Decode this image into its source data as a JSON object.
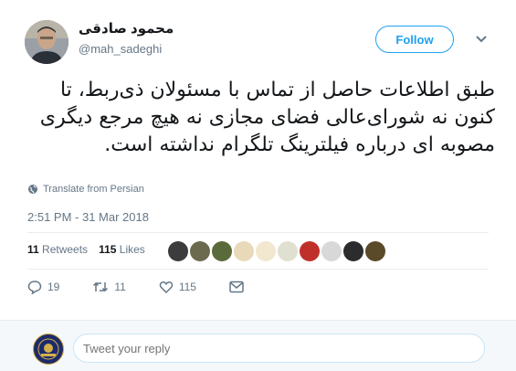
{
  "user": {
    "display_name": "محمود صادقی",
    "handle": "@mah_sadeghi"
  },
  "header": {
    "follow_label": "Follow"
  },
  "tweet": {
    "text": "طبق اطلاعات حاصل از تماس با مسئولان ذی‌ربط، تا کنون نه شورای‌عالی فضای مجازی نه هیچ مرجع دیگری مصوبه ای درباره فیلترینگ تلگرام نداشته است.",
    "translate_label": "Translate from Persian",
    "timestamp": "2:51 PM - 31 Mar 2018"
  },
  "stats": {
    "retweets_count": "11",
    "retweets_label": "Retweets",
    "likes_count": "115",
    "likes_label": "Likes"
  },
  "likers": {
    "colors": [
      "#3c3c3c",
      "#6b6a4e",
      "#5a6a3a",
      "#e8d9b8",
      "#f2e7cf",
      "#e0e0d0",
      "#c0302a",
      "#d8d8d8",
      "#2c2c2c",
      "#5a4a2a"
    ]
  },
  "actions": {
    "replies_count": "19",
    "retweets_count": "11",
    "likes_count": "115"
  },
  "reply": {
    "placeholder": "Tweet your reply"
  },
  "colors": {
    "accent": "#1da1f2",
    "secondary_text": "#657786",
    "divider": "#e6ecf0"
  }
}
